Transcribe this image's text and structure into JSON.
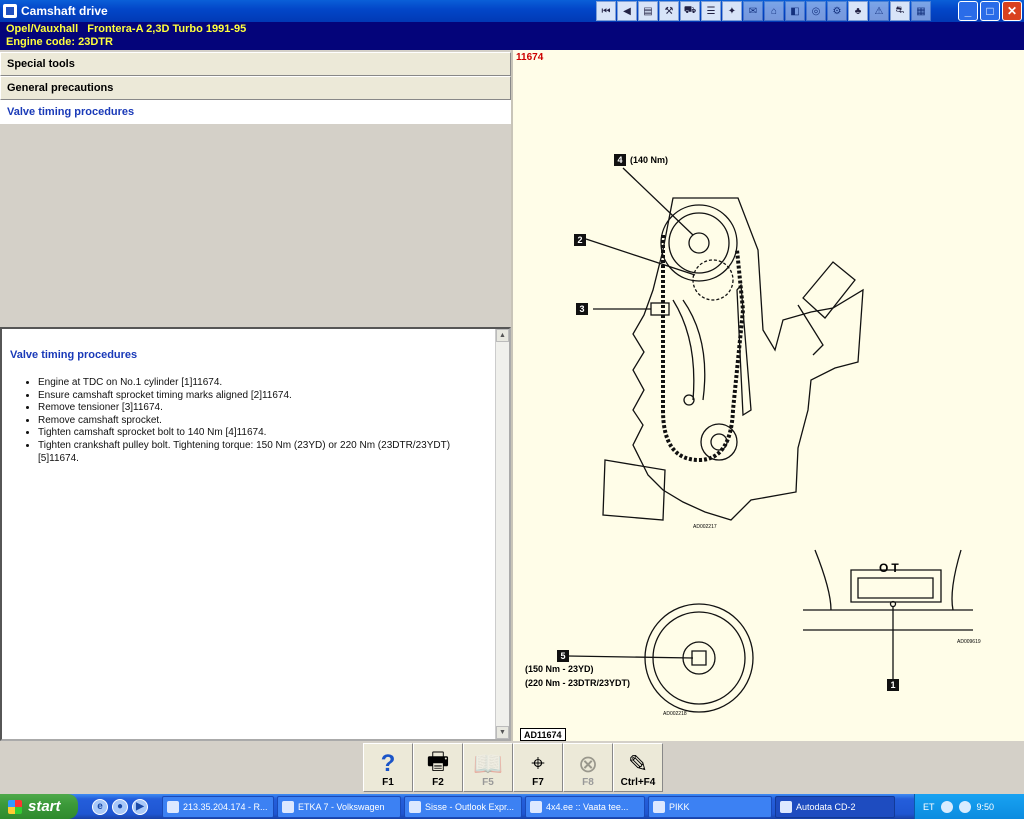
{
  "window": {
    "title": "Camshaft drive",
    "toolbar_icons": [
      "first-icon",
      "prev-icon",
      "book-icon",
      "wrench-icon",
      "car-icon",
      "list-icon",
      "tools-icon",
      "note-icon",
      "home-icon",
      "chart-icon",
      "tyre-icon",
      "gear-icon",
      "engine-icon",
      "warning-icon",
      "car-small-icon",
      "grid-icon"
    ],
    "controls": {
      "minimize": "_",
      "maximize": "□",
      "close": "✕"
    }
  },
  "vehicle": {
    "model": "Opel/Vauxhall   Frontera-A 2,3D Turbo 1991-95",
    "engine_code": "Engine code: 23DTR"
  },
  "sections": {
    "special_tools": "Special tools",
    "general_precautions": "General precautions",
    "valve_timing": "Valve timing procedures"
  },
  "content": {
    "heading": "Valve timing procedures",
    "steps": [
      "Engine at TDC on No.1 cylinder [1]11674.",
      "Ensure camshaft sprocket timing marks aligned [2]11674.",
      "Remove tensioner [3]11674.",
      "Remove camshaft sprocket.",
      "Tighten camshaft sprocket bolt to 140 Nm [4]11674.",
      "Tighten crankshaft pulley bolt. Tightening torque: 150 Nm (23YD) or 220 Nm (23DTR/23YDT) [5]11674."
    ]
  },
  "diagram": {
    "ref": "11674",
    "callouts": {
      "c1": "1",
      "c2": "2",
      "c3": "3",
      "c4": "4",
      "c5": "5"
    },
    "torque_4": "(140 Nm)",
    "torque_5a": "(150 Nm - 23YD)",
    "torque_5b": "(220 Nm - 23DTR/23YDT)",
    "tdc_mark": "OT",
    "code_main": "AD002217",
    "code_tdc": "AD009619",
    "code_pulley": "AD002218",
    "label": "AD11674"
  },
  "fkeys": [
    {
      "label": "F1",
      "icon": "?",
      "enabled": true
    },
    {
      "label": "F2",
      "icon": "🖶",
      "enabled": true
    },
    {
      "label": "F5",
      "icon": "📖",
      "enabled": false
    },
    {
      "label": "F7",
      "icon": "⌖",
      "enabled": true
    },
    {
      "label": "F8",
      "icon": "⊗",
      "enabled": false
    },
    {
      "label": "Ctrl+F4",
      "icon": "✎",
      "enabled": true
    }
  ],
  "taskbar": {
    "start": "start",
    "tasks": [
      "213.35.204.174 - R...",
      "ETKA 7 - Volkswagen",
      "Sisse - Outlook Expr...",
      "4x4.ee :: Vaata tee...",
      "PIKK",
      "Autodata CD-2"
    ],
    "lang": "ET",
    "time": "9:50"
  }
}
